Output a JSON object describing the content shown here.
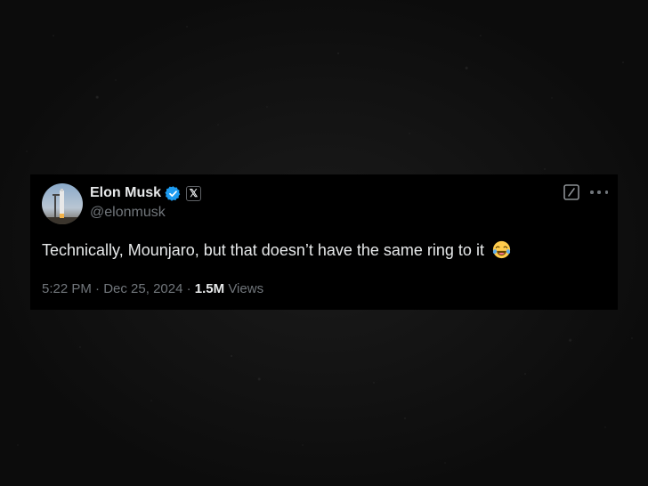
{
  "tweet": {
    "display_name": "Elon Musk",
    "handle": "@elonmusk",
    "text": "Technically, Mounjaro, but that doesn’t have the same ring to it",
    "emoji_icon": "face-with-tears-of-joy-icon",
    "time": "5:22 PM",
    "separator": "·",
    "date": "Dec 25, 2024",
    "views_count": "1.5M",
    "views_label": "Views",
    "affiliation_badge": "𝕏"
  },
  "colors": {
    "card_background": "#000000",
    "primary_text": "#e7e9ea",
    "secondary_text": "#71767b",
    "verified_blue": "#1d9bf0",
    "page_background": "#121212"
  },
  "icons": {
    "verified": "verified-badge-icon",
    "grok": "grok-icon",
    "more": "more-options-icon"
  }
}
